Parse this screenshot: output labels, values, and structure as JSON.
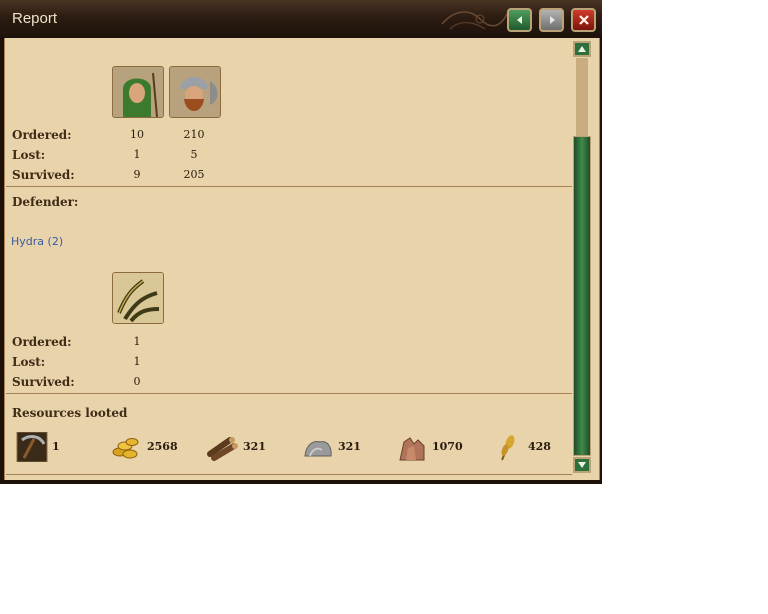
{
  "window": {
    "title": "Report"
  },
  "attacker": {
    "units": [
      {
        "icon": "archer-portrait-icon",
        "ordered": "10",
        "lost": "1",
        "survived": "9"
      },
      {
        "icon": "axeman-portrait-icon",
        "ordered": "210",
        "lost": "5",
        "survived": "205"
      }
    ]
  },
  "labels": {
    "ordered": "Ordered:",
    "lost": "Lost:",
    "survived": "Survived:",
    "defender": "Defender:",
    "resources": "Resources looted"
  },
  "defender": {
    "name": "Hydra (2)",
    "units": [
      {
        "icon": "hydra-portrait-icon",
        "ordered": "1",
        "lost": "1",
        "survived": "0"
      }
    ]
  },
  "resources": [
    {
      "icon": "pickaxe-icon",
      "value": "1"
    },
    {
      "icon": "gold-coins-icon",
      "value": "2568"
    },
    {
      "icon": "wood-logs-icon",
      "value": "321"
    },
    {
      "icon": "stone-icon",
      "value": "321"
    },
    {
      "icon": "ore-icon",
      "value": "1070"
    },
    {
      "icon": "wheat-icon",
      "value": "428"
    }
  ],
  "colors": {
    "panel": "#e8d3ab",
    "titlebar": "#2c1c12",
    "link": "#3a5ba0",
    "scroll_green": "#2f6f3c"
  }
}
